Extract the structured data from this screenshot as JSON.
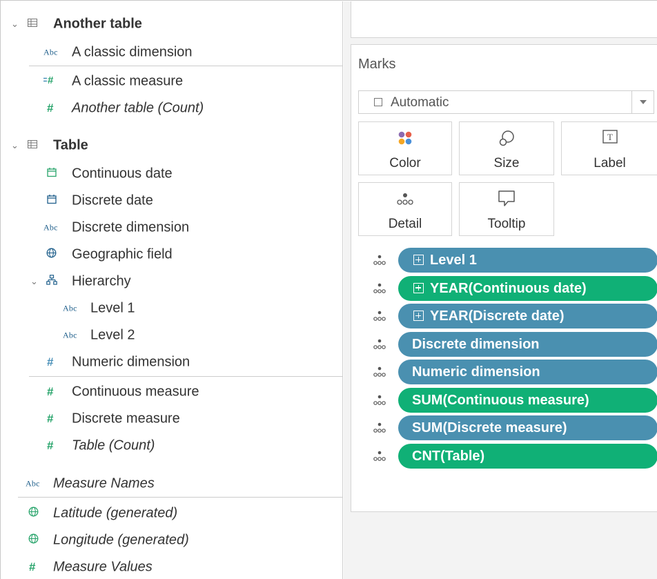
{
  "data_pane": {
    "another_table": {
      "title": "Another table",
      "fields": [
        {
          "label": "A classic dimension",
          "icon": "abc-string-icon"
        },
        {
          "label": "A classic measure",
          "icon": "measure-hash-icon"
        },
        {
          "label": "Another table (Count)",
          "icon": "hash-count-icon"
        }
      ]
    },
    "table": {
      "title": "Table",
      "fields": [
        {
          "label": "Continuous date",
          "icon": "calendar-icon"
        },
        {
          "label": "Discrete date",
          "icon": "calendar-icon"
        },
        {
          "label": "Discrete dimension",
          "icon": "abc-string-icon"
        },
        {
          "label": "Geographic field",
          "icon": "globe-icon"
        },
        {
          "label": "Hierarchy",
          "icon": "hierarchy-icon"
        },
        {
          "label": "Level 1",
          "icon": "abc-string-icon"
        },
        {
          "label": "Level 2",
          "icon": "abc-string-icon"
        },
        {
          "label": "Numeric dimension",
          "icon": "hash-icon"
        },
        {
          "label": "Continuous measure",
          "icon": "hash-icon"
        },
        {
          "label": "Discrete measure",
          "icon": "hash-icon"
        },
        {
          "label": "Table (Count)",
          "icon": "hash-count-icon"
        }
      ]
    },
    "generated": [
      {
        "label": "Measure Names",
        "icon": "abc-string-icon"
      },
      {
        "label": "Latitude (generated)",
        "icon": "globe-icon"
      },
      {
        "label": "Longitude (generated)",
        "icon": "globe-icon"
      },
      {
        "label": "Measure Values",
        "icon": "hash-icon"
      }
    ],
    "abc_text": "Abc"
  },
  "marks": {
    "title": "Marks",
    "mark_type": "Automatic",
    "buttons": [
      {
        "label": "Color",
        "icon": "color-icon"
      },
      {
        "label": "Size",
        "icon": "size-icon"
      },
      {
        "label": "Label",
        "icon": "label-icon"
      },
      {
        "label": "Detail",
        "icon": "detail-icon"
      },
      {
        "label": "Tooltip",
        "icon": "tooltip-icon"
      }
    ],
    "pills": [
      {
        "label": "Level 1",
        "color": "#4a90b0",
        "expandable": true
      },
      {
        "label": "YEAR(Continuous date)",
        "color": "#10b076",
        "expandable": true
      },
      {
        "label": "YEAR(Discrete date)",
        "color": "#4a90b0",
        "expandable": true
      },
      {
        "label": "Discrete dimension",
        "color": "#4a90b0",
        "expandable": false
      },
      {
        "label": "Numeric dimension",
        "color": "#4a90b0",
        "expandable": false
      },
      {
        "label": "SUM(Continuous measure)",
        "color": "#10b076",
        "expandable": false
      },
      {
        "label": "SUM(Discrete measure)",
        "color": "#4a90b0",
        "expandable": false
      },
      {
        "label": "CNT(Table)",
        "color": "#10b076",
        "expandable": false
      }
    ],
    "label_icon_glyph": "T"
  },
  "colors": {
    "dimension_blue": "#4a90b0",
    "measure_green": "#10b076"
  }
}
